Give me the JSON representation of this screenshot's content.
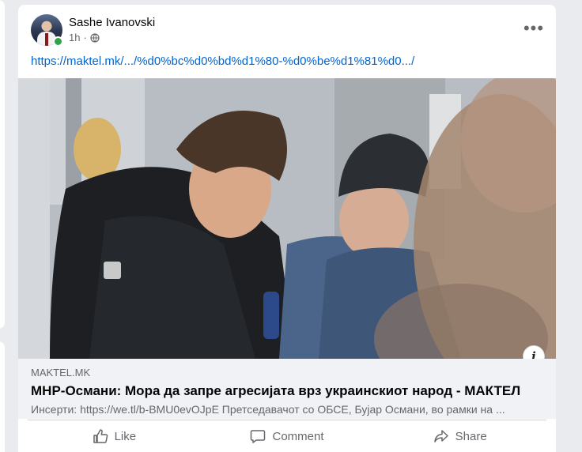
{
  "post": {
    "author": "Sashe Ivanovski",
    "time": "1h",
    "dot": "·",
    "more_label": "•••",
    "link_url": "https://maktel.mk/.../%d0%bc%d0%bd%d1%80-%d0%be%d1%81%d0.../"
  },
  "preview": {
    "domain": "MAKTEL.MK",
    "title": "МНР-Османи: Мора да запре агресијата врз украинскиот народ - МАКТЕЛ",
    "description": "Инсерти: https://we.tl/b-BMU0evOJpE Претседавачот со ОБСЕ, Бујар Османи, во рамки на ..."
  },
  "actions": {
    "like": "Like",
    "comment": "Comment",
    "share": "Share"
  },
  "icons": {
    "avatar": "user-avatar",
    "privacy": "globe-icon",
    "info": "info-icon",
    "like": "thumbs-up-icon",
    "comment": "comment-icon",
    "share": "share-icon"
  },
  "colors": {
    "link": "#0064d1",
    "online": "#31a24c",
    "secondary_text": "#65676b",
    "preview_bg": "#f0f2f5"
  }
}
